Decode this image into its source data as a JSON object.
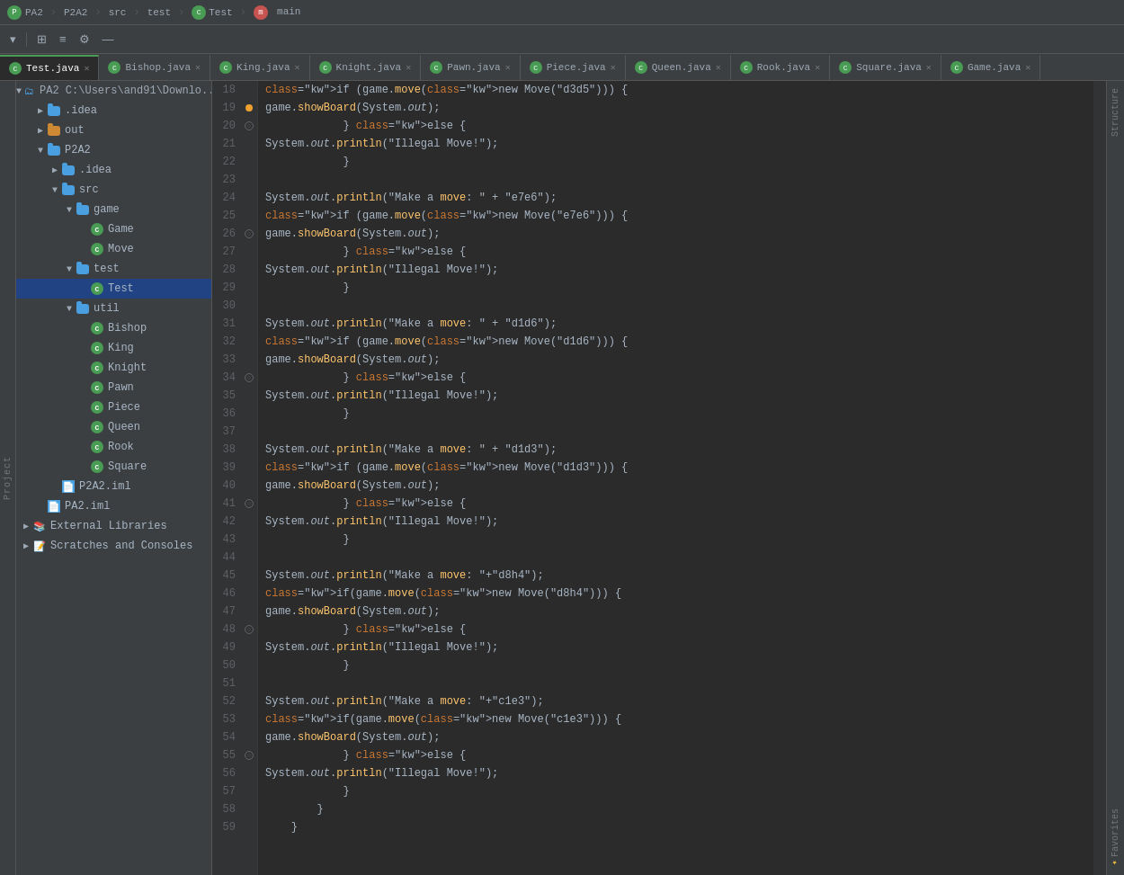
{
  "topbar": {
    "items": [
      "PA2",
      "P2A2",
      "src",
      "test",
      "Test",
      "main"
    ],
    "icons": [
      "PA2",
      "P2A2"
    ]
  },
  "toolbar": {
    "buttons": [
      "▾",
      "⊞",
      "≡",
      "⚙",
      "—"
    ]
  },
  "tabs": [
    {
      "id": "test-java",
      "label": "Test.java",
      "active": true,
      "icon": "C"
    },
    {
      "id": "bishop-java",
      "label": "Bishop.java",
      "active": false,
      "icon": "C"
    },
    {
      "id": "king-java",
      "label": "King.java",
      "active": false,
      "icon": "C"
    },
    {
      "id": "knight-java",
      "label": "Knight.java",
      "active": false,
      "icon": "C"
    },
    {
      "id": "pawn-java",
      "label": "Pawn.java",
      "active": false,
      "icon": "C"
    },
    {
      "id": "piece-java",
      "label": "Piece.java",
      "active": false,
      "icon": "C"
    },
    {
      "id": "queen-java",
      "label": "Queen.java",
      "active": false,
      "icon": "C"
    },
    {
      "id": "rook-java",
      "label": "Rook.java",
      "active": false,
      "icon": "C"
    },
    {
      "id": "square-java",
      "label": "Square.java",
      "active": false,
      "icon": "C"
    },
    {
      "id": "game-java",
      "label": "Game.java",
      "active": false,
      "icon": "C"
    }
  ],
  "sidebar": {
    "header": "Project",
    "tree": [
      {
        "level": 0,
        "type": "project",
        "label": "PA2",
        "sublabel": "C:\\Users\\and91\\Downlo...",
        "expanded": true,
        "icon": "project"
      },
      {
        "level": 1,
        "type": "folder",
        "label": ".idea",
        "expanded": false,
        "icon": "folder-blue"
      },
      {
        "level": 1,
        "type": "folder",
        "label": "out",
        "expanded": false,
        "icon": "folder-orange"
      },
      {
        "level": 1,
        "type": "folder",
        "label": "P2A2",
        "expanded": true,
        "icon": "folder-blue"
      },
      {
        "level": 2,
        "type": "folder",
        "label": ".idea",
        "expanded": false,
        "icon": "folder-blue"
      },
      {
        "level": 2,
        "type": "folder",
        "label": "src",
        "expanded": true,
        "icon": "folder-blue"
      },
      {
        "level": 3,
        "type": "folder",
        "label": "game",
        "expanded": true,
        "icon": "folder-blue"
      },
      {
        "level": 4,
        "type": "class",
        "label": "Game",
        "icon": "class-green"
      },
      {
        "level": 4,
        "type": "class",
        "label": "Move",
        "icon": "class-green"
      },
      {
        "level": 3,
        "type": "folder",
        "label": "test",
        "expanded": true,
        "icon": "folder-blue"
      },
      {
        "level": 4,
        "type": "class",
        "label": "Test",
        "icon": "class-green",
        "selected": true
      },
      {
        "level": 3,
        "type": "folder",
        "label": "util",
        "expanded": true,
        "icon": "folder-blue"
      },
      {
        "level": 4,
        "type": "class",
        "label": "Bishop",
        "icon": "class-green"
      },
      {
        "level": 4,
        "type": "class",
        "label": "King",
        "icon": "class-green"
      },
      {
        "level": 4,
        "type": "class",
        "label": "Knight",
        "icon": "class-green"
      },
      {
        "level": 4,
        "type": "class",
        "label": "Pawn",
        "icon": "class-green"
      },
      {
        "level": 4,
        "type": "class",
        "label": "Piece",
        "icon": "class-green"
      },
      {
        "level": 4,
        "type": "class",
        "label": "Queen",
        "icon": "class-green"
      },
      {
        "level": 4,
        "type": "class",
        "label": "Rook",
        "icon": "class-green"
      },
      {
        "level": 4,
        "type": "class",
        "label": "Square",
        "icon": "class-green"
      },
      {
        "level": 2,
        "type": "iml",
        "label": "P2A2.iml",
        "icon": "iml"
      },
      {
        "level": 1,
        "type": "iml",
        "label": "PA2.iml",
        "icon": "iml"
      },
      {
        "level": 0,
        "type": "ext",
        "label": "External Libraries",
        "expanded": false,
        "icon": "ext"
      },
      {
        "level": 0,
        "type": "scratch",
        "label": "Scratches and Consoles",
        "expanded": false,
        "icon": "scratch"
      }
    ]
  },
  "code": {
    "lines": [
      {
        "num": 18,
        "gutter": "none",
        "content": "            if (game.move(new Move(\"d3d5\"))) {"
      },
      {
        "num": 19,
        "gutter": "dot",
        "content": "                game.showBoard(System.out);"
      },
      {
        "num": 20,
        "gutter": "circle",
        "content": "            } else {"
      },
      {
        "num": 21,
        "gutter": "none",
        "content": "                System.out.println(\"Illegal Move!\");"
      },
      {
        "num": 22,
        "gutter": "none",
        "content": "            }"
      },
      {
        "num": 23,
        "gutter": "none",
        "content": ""
      },
      {
        "num": 24,
        "gutter": "none",
        "content": "            System.out.println(\"Make a move: \" + \"e7e6\");"
      },
      {
        "num": 25,
        "gutter": "none",
        "content": "            if (game.move(new Move(\"e7e6\"))) {"
      },
      {
        "num": 26,
        "gutter": "circle",
        "content": "                game.showBoard(System.out);"
      },
      {
        "num": 27,
        "gutter": "none",
        "content": "            } else {"
      },
      {
        "num": 28,
        "gutter": "none",
        "content": "                System.out.println(\"Illegal Move!\");"
      },
      {
        "num": 29,
        "gutter": "none",
        "content": "            }"
      },
      {
        "num": 30,
        "gutter": "none",
        "content": ""
      },
      {
        "num": 31,
        "gutter": "none",
        "content": "            System.out.println(\"Make a move: \" + \"d1d6\");"
      },
      {
        "num": 32,
        "gutter": "none",
        "content": "            if (game.move(new Move(\"d1d6\"))) {"
      },
      {
        "num": 33,
        "gutter": "none",
        "content": "                game.showBoard(System.out);"
      },
      {
        "num": 34,
        "gutter": "circle",
        "content": "            } else {"
      },
      {
        "num": 35,
        "gutter": "none",
        "content": "                System.out.println(\"Illegal Move!\");"
      },
      {
        "num": 36,
        "gutter": "none",
        "content": "            }"
      },
      {
        "num": 37,
        "gutter": "none",
        "content": ""
      },
      {
        "num": 38,
        "gutter": "none",
        "content": "            System.out.println(\"Make a move: \" + \"d1d3\");"
      },
      {
        "num": 39,
        "gutter": "none",
        "content": "            if (game.move(new Move(\"d1d3\"))) {"
      },
      {
        "num": 40,
        "gutter": "none",
        "content": "                game.showBoard(System.out);"
      },
      {
        "num": 41,
        "gutter": "circle",
        "content": "            } else {"
      },
      {
        "num": 42,
        "gutter": "none",
        "content": "                System.out.println(\"Illegal Move!\");"
      },
      {
        "num": 43,
        "gutter": "none",
        "content": "            }"
      },
      {
        "num": 44,
        "gutter": "none",
        "content": ""
      },
      {
        "num": 45,
        "gutter": "none",
        "content": "            System.out.println(\"Make a move: \"+\"d8h4\");"
      },
      {
        "num": 46,
        "gutter": "none",
        "content": "            if(game.move(new Move(\"d8h4\"))) {"
      },
      {
        "num": 47,
        "gutter": "none",
        "content": "                game.showBoard(System.out);"
      },
      {
        "num": 48,
        "gutter": "circle",
        "content": "            } else {"
      },
      {
        "num": 49,
        "gutter": "none",
        "content": "                System.out.println(\"Illegal Move!\");"
      },
      {
        "num": 50,
        "gutter": "none",
        "content": "            }"
      },
      {
        "num": 51,
        "gutter": "none",
        "content": ""
      },
      {
        "num": 52,
        "gutter": "none",
        "content": "            System.out.println(\"Make a move: \"+\"c1e3\");"
      },
      {
        "num": 53,
        "gutter": "none",
        "content": "            if(game.move(new Move(\"c1e3\"))) {"
      },
      {
        "num": 54,
        "gutter": "none",
        "content": "                game.showBoard(System.out);"
      },
      {
        "num": 55,
        "gutter": "circle",
        "content": "            } else {"
      },
      {
        "num": 56,
        "gutter": "none",
        "content": "                System.out.println(\"Illegal Move!\");"
      },
      {
        "num": 57,
        "gutter": "none",
        "content": "            }"
      },
      {
        "num": 58,
        "gutter": "none",
        "content": "        }"
      },
      {
        "num": 59,
        "gutter": "none",
        "content": "    }"
      }
    ]
  },
  "right_panels": {
    "structure": "Structure",
    "favorites": "Favorites"
  }
}
